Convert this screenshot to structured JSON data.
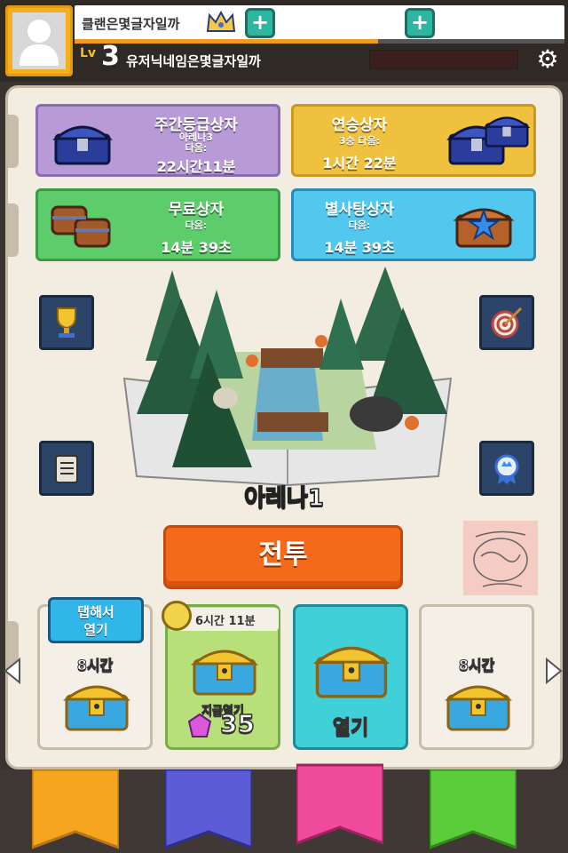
{
  "header": {
    "clan_name": "클랜은몇글자일까",
    "level_prefix": "Lv",
    "level": "3",
    "nickname": "유저닉네임은몇글자일까",
    "xp_progress": 0.62
  },
  "chests": {
    "weekly": {
      "title": "주간등급상자",
      "sub": "아레나3",
      "sub2": "다음:",
      "time": "22시간11분"
    },
    "streak": {
      "title": "연승상자",
      "sub": "3승 다음:",
      "time": "1시간 22분"
    },
    "free": {
      "title": "무료상자",
      "sub": "다음:",
      "time": "14분 39초"
    },
    "star": {
      "title": "별사탕상자",
      "sub": "다음:",
      "time": "14분 39초"
    }
  },
  "arena": {
    "name": "아레나1"
  },
  "battle_label": "전투",
  "slots": {
    "slot1": {
      "badge_line1": "탭해서",
      "badge_line2": "열기",
      "time": "8시간"
    },
    "slot2": {
      "timer": "6시간 11분",
      "open_now": "지금열기",
      "gems": "35"
    },
    "slot3": {
      "open": "열기"
    },
    "slot4": {
      "time": "8시간"
    }
  },
  "colors": {
    "weekly": "#b79ad6",
    "streak": "#f0c13e",
    "free": "#5ccd6a",
    "star": "#52c8ee",
    "battle": "#f46a1a",
    "ribbon_orange": "#f6a51e",
    "ribbon_blue": "#5b5cd6",
    "ribbon_pink": "#f04a9c",
    "ribbon_green": "#5ccd3a"
  }
}
